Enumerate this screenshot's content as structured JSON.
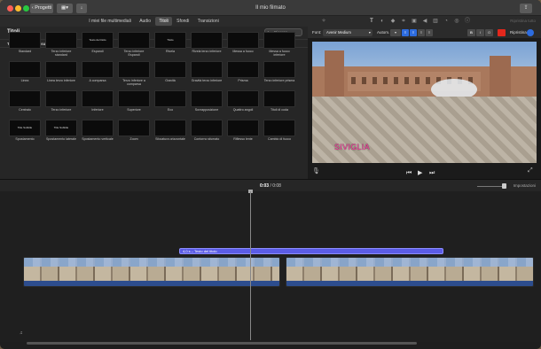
{
  "window": {
    "title": "Il mio filmato",
    "back_button": "Progetti"
  },
  "tabs": [
    {
      "label": "I miei file multimediali",
      "active": false
    },
    {
      "label": "Audio",
      "active": false
    },
    {
      "label": "Titoli",
      "active": true
    },
    {
      "label": "Sfondi",
      "active": false
    },
    {
      "label": "Transizioni",
      "active": false
    }
  ],
  "tools": {
    "reset_all": "Ripristina tutto"
  },
  "browser": {
    "title": "Titoli",
    "search_placeholder": "Ricerca",
    "theme_label": "Tema attuale: Nessun tema",
    "items": [
      {
        "label": "Standard",
        "thumb": ""
      },
      {
        "label": "Terzo inferiore standard",
        "thumb": ""
      },
      {
        "label": "Espandi",
        "thumb": "Testo del titolo"
      },
      {
        "label": "Terzo inferiore Espandi",
        "thumb": ""
      },
      {
        "label": "Rivela",
        "thumb": "Titolo"
      },
      {
        "label": "Rivela terzo inferiore",
        "thumb": ""
      },
      {
        "label": "Messa a fuoco",
        "thumb": ""
      },
      {
        "label": "Messa a fuoco inferiore",
        "thumb": ""
      },
      {
        "label": "Linea",
        "thumb": ""
      },
      {
        "label": "Linea terzo inferiore",
        "thumb": ""
      },
      {
        "label": "A comparsa",
        "thumb": ""
      },
      {
        "label": "Terzo inferiore a comparsa",
        "thumb": ""
      },
      {
        "label": "Gravità",
        "thumb": ""
      },
      {
        "label": "Gravità terzo inferiore",
        "thumb": ""
      },
      {
        "label": "Prisma",
        "thumb": ""
      },
      {
        "label": "Terzo inferiore prisma",
        "thumb": ""
      },
      {
        "label": "Centrato",
        "thumb": ""
      },
      {
        "label": "Terzo inferiore",
        "thumb": ""
      },
      {
        "label": "Inferiore",
        "thumb": ""
      },
      {
        "label": "Superiore",
        "thumb": ""
      },
      {
        "label": "Eco",
        "thumb": ""
      },
      {
        "label": "Sovrapposizione",
        "thumb": ""
      },
      {
        "label": "Quattro angoli",
        "thumb": ""
      },
      {
        "label": "Titoli di coda",
        "thumb": ""
      },
      {
        "label": "Spostamento",
        "thumb": "Title Subtitle"
      },
      {
        "label": "Spostamento laterale",
        "thumb": "Title Subtitle"
      },
      {
        "label": "Spostamento verticale",
        "thumb": ""
      },
      {
        "label": "Zoom",
        "thumb": ""
      },
      {
        "label": "Sfocatura orizzontale",
        "thumb": ""
      },
      {
        "label": "Contorno sfumato",
        "thumb": ""
      },
      {
        "label": "Riflesso lente",
        "thumb": ""
      },
      {
        "label": "Cambio di fuoco",
        "thumb": ""
      }
    ]
  },
  "viewer": {
    "font_label": "Font:",
    "font_value": "Avenir Medium",
    "auto_label": "Autom.",
    "reset_label": "Ripristina",
    "caption": "SIVIGLIA",
    "accent_color": "#e3271c"
  },
  "timeline": {
    "current_time": "0:03",
    "total_time": "0:08",
    "separator": "/",
    "settings_label": "Impostazioni",
    "title_clip": "4,0 s – Testo del titolo"
  }
}
